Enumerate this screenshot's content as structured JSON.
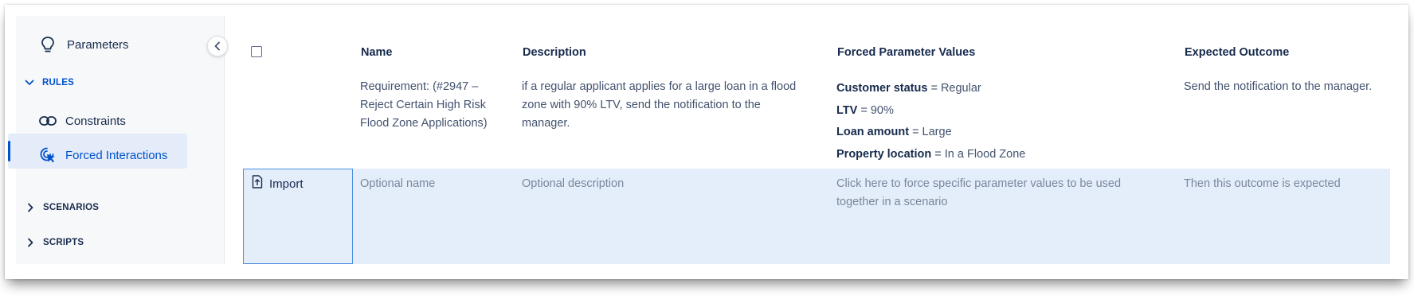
{
  "sidebar": {
    "parameters_label": "Parameters",
    "rules_section": "RULES",
    "constraints_label": "Constraints",
    "forced_interactions_label": "Forced Interactions",
    "scenarios_section": "SCENARIOS",
    "scripts_section": "SCRIPTS"
  },
  "table": {
    "headers": {
      "name": "Name",
      "description": "Description",
      "forced_values": "Forced Parameter Values",
      "expected_outcome": "Expected Outcome"
    },
    "row": {
      "name_lines": [
        "Requirement: (#2947 –",
        "Reject Certain High Risk",
        "Flood Zone Applications)"
      ],
      "description_lines": [
        "if a regular applicant applies for a large loan in a flood",
        "zone with 90% LTV, send the notification to the",
        "manager."
      ],
      "forced_values": [
        {
          "key": "Customer status",
          "value": "= Regular"
        },
        {
          "key": "LTV",
          "value": "= 90%"
        },
        {
          "key": "Loan amount",
          "value": "= Large"
        },
        {
          "key": "Property location",
          "value": "= In a Flood Zone"
        }
      ],
      "expected_outcome": "Send the notification to the manager."
    },
    "new_row": {
      "import_label": "Import",
      "name_placeholder": "Optional name",
      "description_placeholder": "Optional description",
      "forced_values_placeholder_lines": [
        "Click here to force specific parameter values to be used",
        "together in a scenario"
      ],
      "expected_outcome_placeholder": "Then this outcome is expected"
    }
  },
  "colors": {
    "accent": "#0052cc",
    "selected_bg": "#e4ecf9",
    "new_row_bg": "#e4eefb",
    "import_border": "#4c8ee0"
  }
}
